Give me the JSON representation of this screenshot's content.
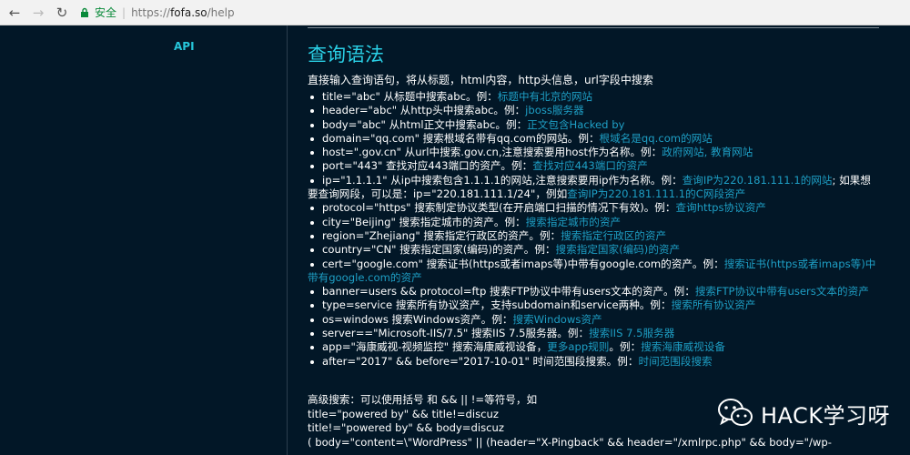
{
  "browser": {
    "secure_label": "安全",
    "url_scheme": "https://",
    "url_host": "fofa.so",
    "url_path": "/help"
  },
  "sidebar": {
    "api_label": "API"
  },
  "main": {
    "title": "查询语法",
    "intro": "直接输入查询语句，将从标题，html内容，http头信息，url字段中搜索",
    "items": [
      {
        "text": "title=\"abc\" 从标题中搜索abc。例：",
        "link": "标题中有北京的网站"
      },
      {
        "text": "header=\"abc\" 从http头中搜索abc。例：",
        "link": "jboss服务器"
      },
      {
        "text": "body=\"abc\" 从html正文中搜索abc。例：",
        "link": "正文包含Hacked by"
      },
      {
        "text": "domain=\"qq.com\" 搜索根域名带有qq.com的网站。例：",
        "link": "根域名是qq.com的网站"
      },
      {
        "text": "host=\".gov.cn\" 从url中搜索.gov.cn,注意搜索要用host作为名称。例：",
        "link": "政府网站, 教育网站"
      },
      {
        "text": "port=\"443\" 查找对应443端口的资产。例：",
        "link": "查找对应443端口的资产"
      },
      {
        "text": "ip=\"1.1.1.1\" 从ip中搜索包含1.1.1.1的网站,注意搜索要用ip作为名称。例：",
        "link": "查询IP为220.181.111.1的网站",
        "text2": "; 如果想要查询网段，可以是：ip=\"220.181.111.1/24\"，例如",
        "link2": "查询IP为220.181.111.1的C网段资产"
      },
      {
        "text": "protocol=\"https\" 搜索制定协议类型(在开启端口扫描的情况下有效)。例：",
        "link": "查询https协议资产"
      },
      {
        "text": "city=\"Beijing\" 搜索指定城市的资产。例：",
        "link": "搜索指定城市的资产"
      },
      {
        "text": "region=\"Zhejiang\" 搜索指定行政区的资产。例：",
        "link": "搜索指定行政区的资产"
      },
      {
        "text": "country=\"CN\" 搜索指定国家(编码)的资产。例：",
        "link": "搜索指定国家(编码)的资产"
      },
      {
        "text": "cert=\"google.com\" 搜索证书(https或者imaps等)中带有google.com的资产。例：",
        "link": "搜索证书(https或者imaps等)中带有google.com的资产"
      },
      {
        "text": "banner=users && protocol=ftp 搜索FTP协议中带有users文本的资产。例：",
        "link": "搜索FTP协议中带有users文本的资产"
      },
      {
        "text": "type=service 搜索所有协议资产，支持subdomain和service两种。例：",
        "link": "搜索所有协议资产"
      },
      {
        "text": "os=windows 搜索Windows资产。例：",
        "link": "搜索Windows资产"
      },
      {
        "text": "server==\"Microsoft-IIS/7.5\" 搜索IIS 7.5服务器。例：",
        "link": "搜索IIS 7.5服务器"
      },
      {
        "text": "app=\"海康威视-视频监控\" 搜索海康威视设备，",
        "link": "更多app规则",
        "text2": "。例：",
        "link2": "搜索海康威视设备"
      },
      {
        "text": "after=\"2017\" && before=\"2017-10-01\" 时间范围段搜索。例：",
        "link": "时间范围段搜索"
      }
    ],
    "advanced_heading": "高级搜索：可以使用括号 和 && || !=等符号，如",
    "advanced_examples": [
      "title=\"powered by\" && title!=discuz",
      "title!=\"powered by\" && body=discuz",
      "( body=\"content=\\\"WordPress\" || (header=\"X-Pingback\" && header=\"/xmlrpc.php\" && body=\"/wp-"
    ]
  },
  "watermark": {
    "text": "HACK学习呀",
    "icon": "wechat-icon"
  }
}
